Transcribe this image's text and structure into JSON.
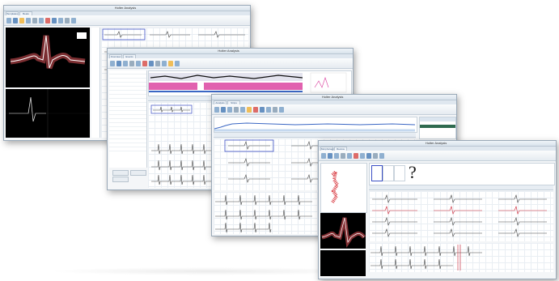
{
  "windows": [
    {
      "title": "Holter Analysis",
      "tabs": [
        "Templates",
        "Beats"
      ]
    },
    {
      "title": "Holter Analysis",
      "tabs": [
        "Overview",
        "Events"
      ]
    },
    {
      "title": "Holter Analysis",
      "tabs": [
        "Analysis",
        "Strips"
      ]
    },
    {
      "title": "Holter Analysis",
      "tabs": [
        "Morphology",
        "Review"
      ]
    }
  ],
  "question_mark": "?",
  "colors": {
    "accent": "#4e7fb7",
    "ecg_red": "#e0535a",
    "hist_magenta": "#d9399b",
    "hist_blue": "#3b67c4"
  },
  "icons": [
    "record-icon",
    "print-icon",
    "zoom-icon",
    "settings-icon",
    "delete-icon",
    "save-icon"
  ]
}
